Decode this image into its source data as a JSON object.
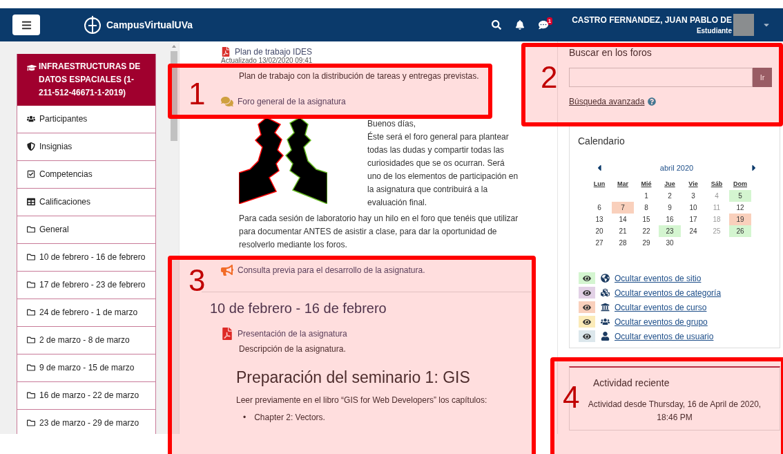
{
  "navbar": {
    "brand": "CampusVirtualUVa",
    "notification_count": "1",
    "user_name": "CASTRO FERNANDEZ, JUAN PABLO DE",
    "user_role": "Estudiante"
  },
  "course_menu": {
    "title": "INFRAESTRUCTURAS DE DATOS ESPACIALES (1-211-512-46671-1-2019)",
    "items": [
      {
        "label": "Participantes",
        "kind": "users"
      },
      {
        "label": "Insignias",
        "kind": "shield"
      },
      {
        "label": "Competencias",
        "kind": "check"
      },
      {
        "label": "Calificaciones",
        "kind": "table"
      },
      {
        "label": "General",
        "kind": "folder"
      },
      {
        "label": "10 de febrero - 16 de febrero",
        "kind": "folder"
      },
      {
        "label": "17 de febrero - 23 de febrero",
        "kind": "folder"
      },
      {
        "label": "24 de febrero - 1 de marzo",
        "kind": "folder"
      },
      {
        "label": "2 de marzo - 8 de marzo",
        "kind": "folder"
      },
      {
        "label": "9 de marzo - 15 de marzo",
        "kind": "folder"
      },
      {
        "label": "16 de marzo - 22 de marzo",
        "kind": "folder"
      },
      {
        "label": "23 de marzo - 29 de marzo",
        "kind": "folder"
      }
    ]
  },
  "content": [
    {
      "kind": "file",
      "text": "Plan de trabajo IDES"
    },
    {
      "kind": "meta",
      "text": "Actualizado 13/02/2020 09:41"
    },
    {
      "kind": "description",
      "text": "Plan de trabajo con la distribución de tareas y entregas previstas."
    },
    {
      "kind": "forum",
      "text": "Foro general de la asignatura"
    },
    {
      "kind": "intro",
      "greeting": "Buenos días,",
      "text": "Éste será el foro general para plantear todas las dudas y compartir todas las curiosidades que se os ocurran. Será uno de los elementos de participación en la asignatura que contribuirá a la evaluación final."
    },
    {
      "kind": "description",
      "text": "Para cada sesión de laboratorio hay un hilo en el foro que tenéis que utilizar para documentar ANTES de asistir a clase, para dar la oportunidad de resolverlo mediante los foros."
    },
    {
      "kind": "announcement",
      "text": "Consulta previa para el desarrollo de la asignatura."
    },
    {
      "kind": "section",
      "text": "10 de febrero - 16 de febrero"
    },
    {
      "kind": "file",
      "text": "Presentación de la asignatura"
    },
    {
      "kind": "description",
      "text": "Descripción de la asignatura."
    },
    {
      "kind": "heading",
      "text": "Preparación del seminario 1: GIS"
    },
    {
      "kind": "paragraph",
      "text": "Leer previamente en el libro “GIS for Web Developers” los capítulos:"
    },
    {
      "kind": "bullet",
      "marker": "•",
      "text": "Chapter 2: Vectors."
    }
  ],
  "forum_search": {
    "title": "Buscar en los foros",
    "button": "Ir",
    "advanced_link": "Búsqueda avanzada"
  },
  "calendar": {
    "title": "Calendario",
    "month": "abril 2020",
    "weekdays": [
      "Lun",
      "Mar",
      "Mié",
      "Jue",
      "Vie",
      "Sáb",
      "Dom"
    ],
    "weeks": [
      [
        {
          "day": "1"
        },
        {
          "day": "2"
        },
        {
          "day": "3"
        },
        {
          "day": "4"
        },
        {
          "day": "5",
          "color": "#d4f5d0"
        }
      ],
      [
        {
          "day": "6"
        },
        {
          "day": "7",
          "color": "#f9d0bc"
        },
        {
          "day": "8"
        },
        {
          "day": "9"
        },
        {
          "day": "10"
        },
        {
          "day": "11"
        },
        {
          "day": "12"
        }
      ],
      [
        {
          "day": "13"
        },
        {
          "day": "14"
        },
        {
          "day": "15"
        },
        {
          "day": "16"
        },
        {
          "day": "17"
        },
        {
          "day": "18"
        },
        {
          "day": "19",
          "color": "#f9d0bc"
        }
      ],
      [
        {
          "day": "20"
        },
        {
          "day": "21"
        },
        {
          "day": "22"
        },
        {
          "day": "23",
          "color": "#d4f5d0"
        },
        {
          "day": "24"
        },
        {
          "day": "25"
        },
        {
          "day": "26",
          "color": "#d4f5d0"
        }
      ],
      [
        {
          "day": "27"
        },
        {
          "day": "28"
        },
        {
          "day": "29"
        },
        {
          "day": "30"
        }
      ]
    ],
    "event_filters": [
      {
        "label": "Ocultar eventos de sitio",
        "kind": "site",
        "color": "#d4f5d0"
      },
      {
        "label": "Ocultar eventos de categoría",
        "kind": "category",
        "color": "#e2d1e6"
      },
      {
        "label": "Ocultar eventos de curso",
        "kind": "course",
        "color": "#f9d0bc"
      },
      {
        "label": "Ocultar eventos de grupo",
        "kind": "group",
        "color": "#fbebb8"
      },
      {
        "label": "Ocultar eventos de usuario",
        "kind": "user",
        "color": "#dce7ec"
      }
    ]
  },
  "recent_activity": {
    "title": "Actividad reciente",
    "text": "Actividad desde Thursday, 16 de April de 2020, 18:46 PM"
  },
  "annotations": [
    {
      "label": "1"
    },
    {
      "label": "2"
    },
    {
      "label": "3"
    },
    {
      "label": "4"
    }
  ]
}
